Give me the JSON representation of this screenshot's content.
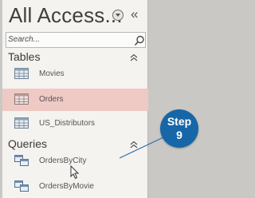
{
  "nav_pane": {
    "title": "All Access...",
    "menu_icon": "circle-dropdown-icon",
    "collapse_icon": "double-chevron-left-icon",
    "search": {
      "placeholder": "Search...",
      "icon": "search-icon"
    }
  },
  "groups": [
    {
      "label": "Tables",
      "chevron_icon": "double-chevron-up-icon",
      "items": [
        {
          "label": "Movies",
          "icon": "table-icon",
          "selected": false
        },
        {
          "label": "Orders",
          "icon": "table-icon",
          "selected": true
        },
        {
          "label": "US_Distributors",
          "icon": "table-icon",
          "selected": false
        }
      ]
    },
    {
      "label": "Queries",
      "chevron_icon": "double-chevron-up-icon",
      "items": [
        {
          "label": "OrdersByCity",
          "icon": "query-icon",
          "selected": false
        },
        {
          "label": "OrdersByMovie",
          "icon": "query-icon",
          "selected": false
        }
      ]
    }
  ],
  "callout": {
    "line1": "Step",
    "line2": "9",
    "color": "#1766a8"
  },
  "colors": {
    "selected_row": "#efc9c4",
    "pane_background": "#f4f3f0"
  }
}
